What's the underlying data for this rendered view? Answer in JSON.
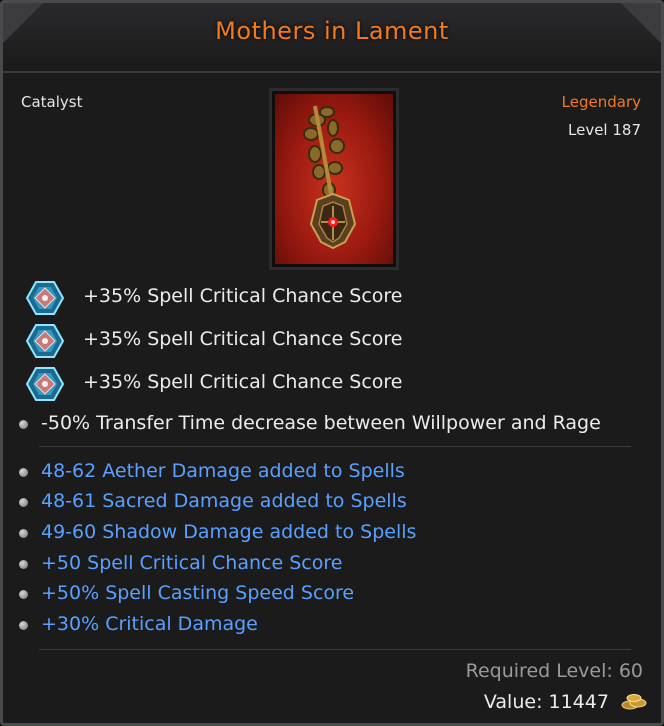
{
  "item": {
    "name": "Mothers in Lament",
    "type": "Catalyst",
    "rarity": "Legendary",
    "level": "Level 187"
  },
  "gem_stats": [
    "+35% Spell Critical Chance Score",
    "+35% Spell Critical Chance Score",
    "+35% Spell Critical Chance Score"
  ],
  "base_stat": "-50% Transfer Time decrease between Willpower and Rage",
  "magic_stats": [
    "48-62 Aether Damage added to Spells",
    "48-61 Sacred Damage added to Spells",
    "49-60 Shadow Damage added to Spells",
    "+50 Spell Critical Chance Score",
    "+50% Spell Casting Speed Score",
    "+30% Critical Damage"
  ],
  "footer": {
    "required_level": "Required Level: 60",
    "value": "Value: 11447"
  },
  "icons": {
    "gem": "gem-socket-icon",
    "coins": "gold-coins-icon",
    "bullet": "bullet-icon"
  },
  "colors": {
    "title": "#f07a22",
    "rarity": "#f07a22",
    "magic_stat": "#5aa0ff",
    "base_stat": "#ececec",
    "required": "#9a9a9a"
  }
}
